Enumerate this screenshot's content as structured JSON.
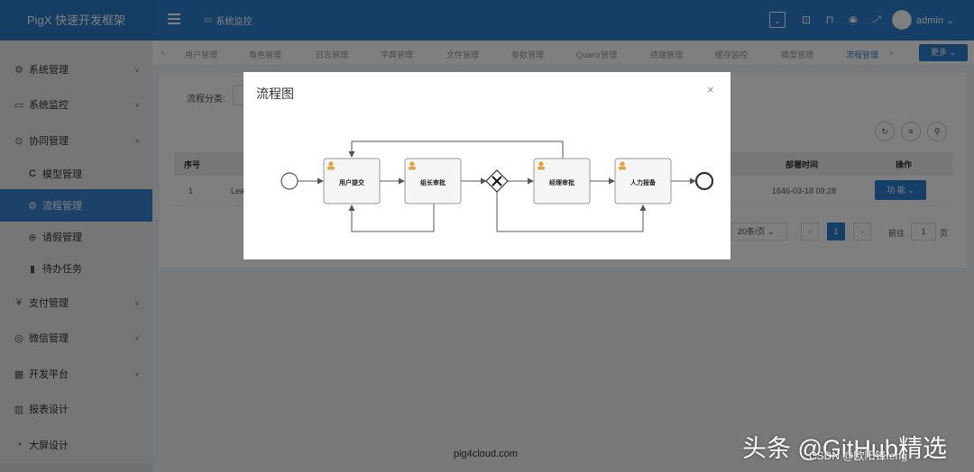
{
  "header": {
    "logo": "PigX 快速开发框架",
    "current_module": "系统监控",
    "user": "admin"
  },
  "sidebar": {
    "items": [
      {
        "label": "系统管理",
        "icon": "gear-icon"
      },
      {
        "label": "系统监控",
        "icon": "monitor-icon"
      },
      {
        "label": "协同管理",
        "icon": "sync-icon"
      },
      {
        "label": "模型管理",
        "icon": "c-icon"
      },
      {
        "label": "流程管理",
        "icon": "process-icon"
      },
      {
        "label": "请假管理",
        "icon": "leave-icon"
      },
      {
        "label": "待办任务",
        "icon": "task-icon"
      },
      {
        "label": "支付管理",
        "icon": "yen-icon"
      },
      {
        "label": "微信管理",
        "icon": "wechat-icon"
      },
      {
        "label": "开发平台",
        "icon": "dev-icon"
      },
      {
        "label": "报表设计",
        "icon": "chart-icon"
      },
      {
        "label": "大屏设计",
        "icon": "pie-icon"
      }
    ]
  },
  "tabs": [
    "用户管理",
    "角色管理",
    "日志管理",
    "字典管理",
    "文件管理",
    "参数管理",
    "Quartz管理",
    "终端管理",
    "缓存监控",
    "模型管理",
    "流程管理"
  ],
  "more_label": "更多",
  "main": {
    "filter_label": "流程分类:",
    "columns": [
      "序号",
      "部署时间",
      "操作"
    ],
    "row": {
      "index": "1",
      "name_partial": "Lea",
      "deploy_time": "1646-03-18 09:28",
      "action": "功 能"
    },
    "page_size": "20条/页",
    "current_page": "1",
    "goto_prefix": "前往",
    "goto_value": "1",
    "goto_suffix": "页"
  },
  "modal": {
    "title": "流程图",
    "close": "×",
    "nodes": [
      "用户提交",
      "组长审批",
      "经理审批",
      "人力报备"
    ]
  },
  "footer": "pig4cloud.com",
  "watermark": {
    "main": "头条 @GitHub精选",
    "sub": "CSDN @欧阳锋feng"
  }
}
